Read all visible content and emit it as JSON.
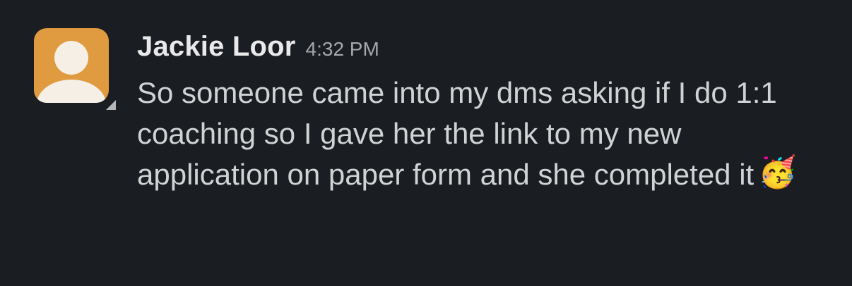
{
  "message": {
    "author_name": "Jackie Loor",
    "timestamp": "4:32 PM",
    "body_text": "So someone came into my dms asking if I do 1:1 coaching so I gave her the link to my new application on paper form and she completed it",
    "emoji": "🥳",
    "avatar": {
      "icon": "default-user-icon",
      "background_color": "#e09a3f",
      "foreground_color": "#f5efe6"
    }
  },
  "theme": {
    "background": "#1a1d21",
    "text": "#d1d2d3",
    "name_text": "#e9e9ea",
    "time_text": "#a7a8ab"
  }
}
